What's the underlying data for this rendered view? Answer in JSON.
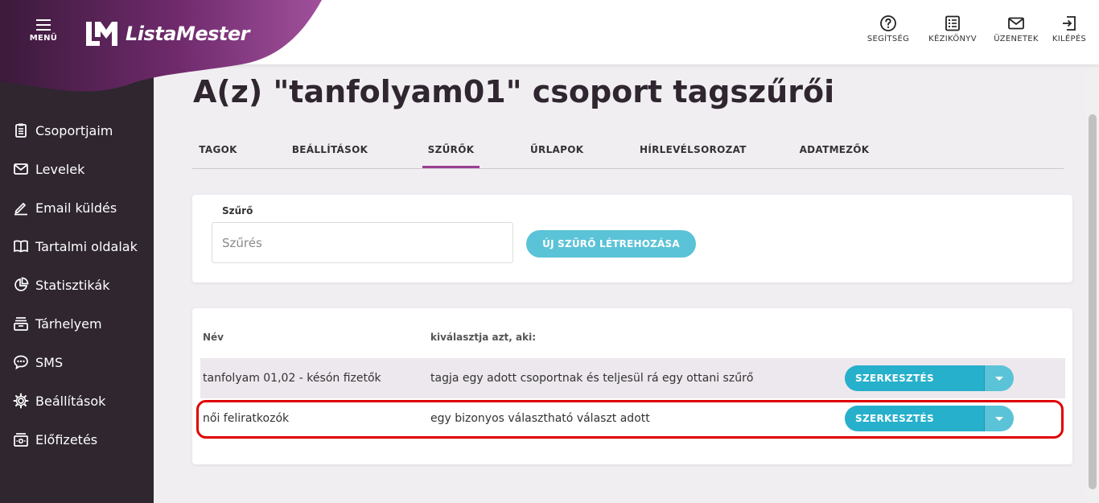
{
  "header": {
    "menu_label": "MENÜ",
    "logo_text": "ListaMester",
    "actions": [
      {
        "label": "SEGÍTSÉG",
        "icon": "help-circle-icon"
      },
      {
        "label": "KÉZIKÖNYV",
        "icon": "manual-icon"
      },
      {
        "label": "ÜZENETEK",
        "icon": "mail-icon"
      },
      {
        "label": "KILÉPÉS",
        "icon": "logout-icon"
      }
    ]
  },
  "sidebar": {
    "items": [
      {
        "label": "Csoportjaim",
        "icon": "clipboard-icon"
      },
      {
        "label": "Levelek",
        "icon": "envelope-icon"
      },
      {
        "label": "Email küldés",
        "icon": "pencil-icon"
      },
      {
        "label": "Tartalmi oldalak",
        "icon": "book-icon"
      },
      {
        "label": "Statisztikák",
        "icon": "pie-chart-icon"
      },
      {
        "label": "Tárhelyem",
        "icon": "storage-icon"
      },
      {
        "label": "SMS",
        "icon": "sms-icon"
      },
      {
        "label": "Beállítások",
        "icon": "gear-icon"
      },
      {
        "label": "Előfizetés",
        "icon": "subscription-icon"
      }
    ]
  },
  "page": {
    "title": "A(z) \"tanfolyam01\" csoport tagszűrői"
  },
  "tabs": [
    {
      "label": "TAGOK"
    },
    {
      "label": "BEÁLLÍTÁSOK"
    },
    {
      "label": "SZŰRŐK",
      "active": true
    },
    {
      "label": "ŰRLAPOK"
    },
    {
      "label": "HÍRLEVÉLSOROZAT"
    },
    {
      "label": "ADATMEZŐK"
    }
  ],
  "filter": {
    "label": "Szűrő",
    "placeholder": "Szűrés",
    "value": "",
    "new_button": "ÚJ SZŰRŐ LÉTREHOZÁSA"
  },
  "table": {
    "headers": [
      "Név",
      "kiválasztja azt, aki:"
    ],
    "rows": [
      {
        "name": "tanfolyam 01,02 - késón fizetők",
        "description": "tagja egy adott csoportnak és teljesül rá egy ottani szűrő",
        "action": "SZERKESZTÉS"
      },
      {
        "name": "női feliratkozók",
        "description": "egy bizonyos választható választ adott",
        "action": "SZERKESZTÉS"
      }
    ]
  },
  "colors": {
    "sidebar_bg": "#2f262f",
    "brand_purple": "#7a2f78",
    "accent_teal": "#26b0cc",
    "light_teal": "#5bc3d7",
    "highlight_red": "#e00000"
  }
}
